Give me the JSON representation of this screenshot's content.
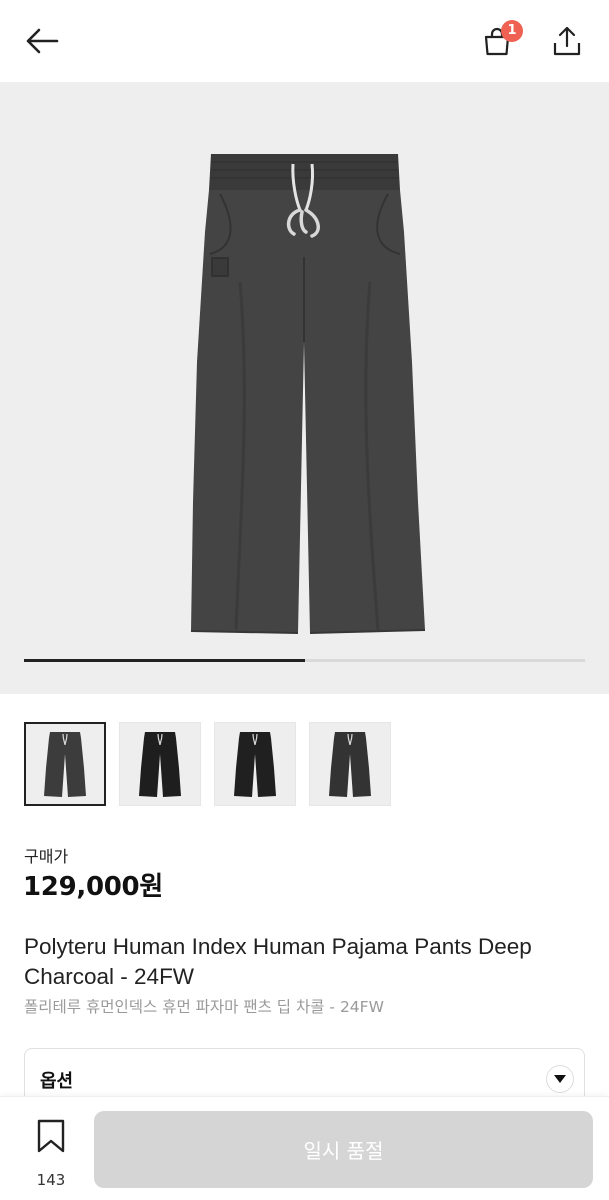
{
  "header": {
    "back_icon": "arrow-left-icon",
    "bag_icon": "shopping-bag-icon",
    "bag_count": "1",
    "share_icon": "share-icon"
  },
  "gallery": {
    "image": "charcoal-wide-pajama-pants",
    "progress_fraction": 0.5
  },
  "thumbnails": [
    {
      "name": "thumbnail-1",
      "selected": true,
      "color": "#3c3c3c"
    },
    {
      "name": "thumbnail-2",
      "selected": false,
      "color": "#1e1e1e"
    },
    {
      "name": "thumbnail-3",
      "selected": false,
      "color": "#202020"
    },
    {
      "name": "thumbnail-4",
      "selected": false,
      "color": "#333333"
    }
  ],
  "product": {
    "price_label": "구매가",
    "price": "129,000원",
    "title_en": "Polyteru Human Index Human Pajama Pants Deep Charcoal - 24FW",
    "title_ko": "폴리테루 휴먼인덱스 휴먼 파자마 팬츠 딥 차콜 - 24FW"
  },
  "option": {
    "label": "옵션",
    "arrow_icon": "caret-down-icon"
  },
  "bottom": {
    "bookmark_icon": "bookmark-icon",
    "bookmark_count": "143",
    "action_label": "일시 품절"
  },
  "colors": {
    "badge": "#ef6253",
    "disabled_button": "#d5d5d5",
    "gallery_bg": "#eeeeee"
  }
}
